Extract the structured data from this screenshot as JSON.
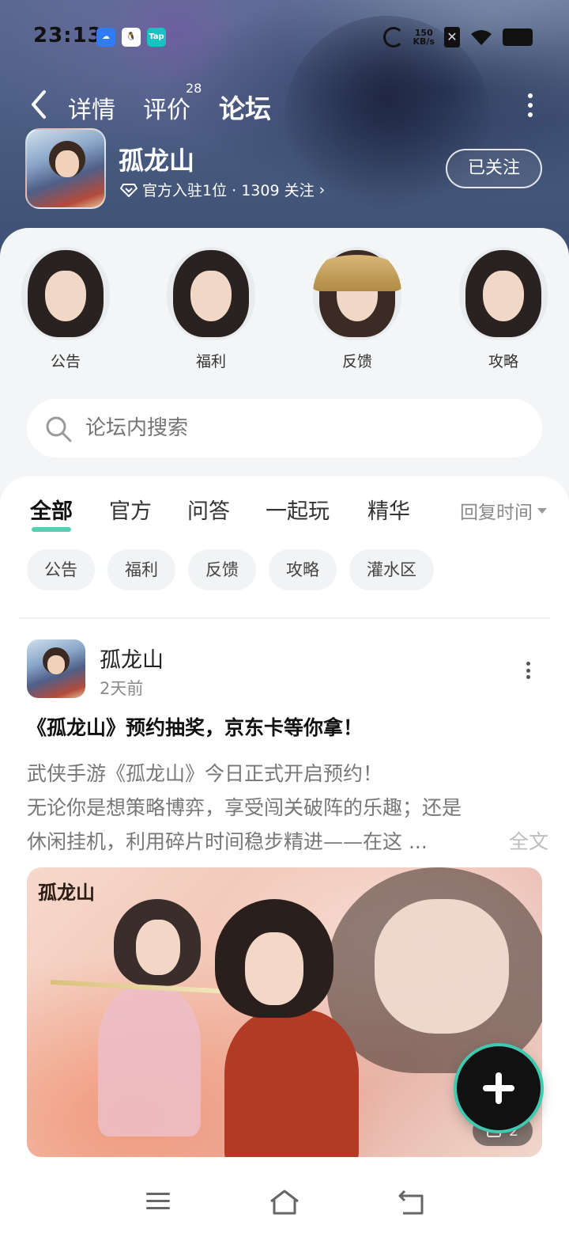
{
  "status_bar": {
    "time": "23:13",
    "apps": [
      "baidu-netdisk",
      "qq",
      "taptap"
    ],
    "tap_label": "Tap",
    "net_speed_value": "150",
    "net_speed_unit": "KB/s"
  },
  "nav": {
    "tabs": [
      {
        "label": "详情"
      },
      {
        "label": "评价"
      },
      {
        "label": "论坛"
      }
    ],
    "reviews_badge": "28",
    "active_tab": "论坛"
  },
  "game": {
    "name": "孤龙山",
    "meta": "官方入驻1位 · 1309 关注",
    "follow_label": "已关注"
  },
  "categories": [
    {
      "label": "公告"
    },
    {
      "label": "福利"
    },
    {
      "label": "反馈"
    },
    {
      "label": "攻略"
    }
  ],
  "search": {
    "placeholder": "论坛内搜索"
  },
  "feed_tabs": [
    {
      "label": "全部"
    },
    {
      "label": "官方"
    },
    {
      "label": "问答"
    },
    {
      "label": "一起玩"
    },
    {
      "label": "精华"
    }
  ],
  "sort_label": "回复时间",
  "chips": [
    {
      "label": "公告"
    },
    {
      "label": "福利"
    },
    {
      "label": "反馈"
    },
    {
      "label": "攻略"
    },
    {
      "label": "灌水区"
    }
  ],
  "post": {
    "author": "孤龙山",
    "time": "2天前",
    "title": "《孤龙山》预约抽奖，京东卡等你拿！",
    "body_lines": [
      "武侠手游《孤龙山》今日正式开启预约！",
      "无论你是想策略博弈，享受闯关破阵的乐趣；还是",
      "休闲挂机，利用碎片时间稳步精进——在这 ..."
    ],
    "read_more": "全文",
    "banner_title": "孤龙山",
    "image_count": "2"
  },
  "colors": {
    "accent": "#4fd1b2",
    "hero_bg": "#4a5d82",
    "sheet_bg": "#f3f5f7"
  }
}
